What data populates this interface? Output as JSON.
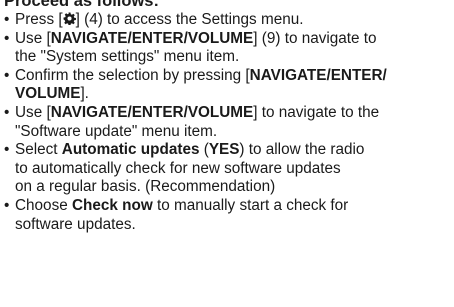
{
  "heading": "Proceed as follows:",
  "bullet": "•",
  "steps": [
    {
      "lines": [
        [
          {
            "t": "Press ["
          },
          {
            "icon": "gear-icon"
          },
          {
            "t": "] (4) to access the Settings menu."
          }
        ]
      ]
    },
    {
      "lines": [
        [
          {
            "t": "Use ["
          },
          {
            "t": "NAVIGATE/ENTER/VOLUME",
            "b": true
          },
          {
            "t": "] (9) to navigate to"
          }
        ],
        [
          {
            "t": "the \"System settings\" menu item."
          }
        ]
      ]
    },
    {
      "lines": [
        [
          {
            "t": "Confirm the selection by pressing ["
          },
          {
            "t": "NAVIGATE/ENTER/",
            "b": true
          }
        ],
        [
          {
            "t": "VOLUME",
            "b": true
          },
          {
            "t": "]."
          }
        ]
      ]
    },
    {
      "lines": [
        [
          {
            "t": "Use ["
          },
          {
            "t": "NAVIGATE/ENTER/VOLUME",
            "b": true
          },
          {
            "t": "] to navigate to the"
          }
        ],
        [
          {
            "t": "\"Software update\" menu item."
          }
        ]
      ]
    },
    {
      "lines": [
        [
          {
            "t": "Select "
          },
          {
            "t": "Automatic updates",
            "b": true
          },
          {
            "t": " ("
          },
          {
            "t": "YES",
            "b": true
          },
          {
            "t": ") to allow the radio"
          }
        ],
        [
          {
            "t": "to automatically check for new software updates"
          }
        ],
        [
          {
            "t": "on a regular basis. (Recommendation)"
          }
        ]
      ]
    },
    {
      "lines": [
        [
          {
            "t": "Choose "
          },
          {
            "t": "Check now",
            "b": true
          },
          {
            "t": " to manually start a check for"
          }
        ],
        [
          {
            "t": "software updates."
          }
        ]
      ]
    }
  ]
}
